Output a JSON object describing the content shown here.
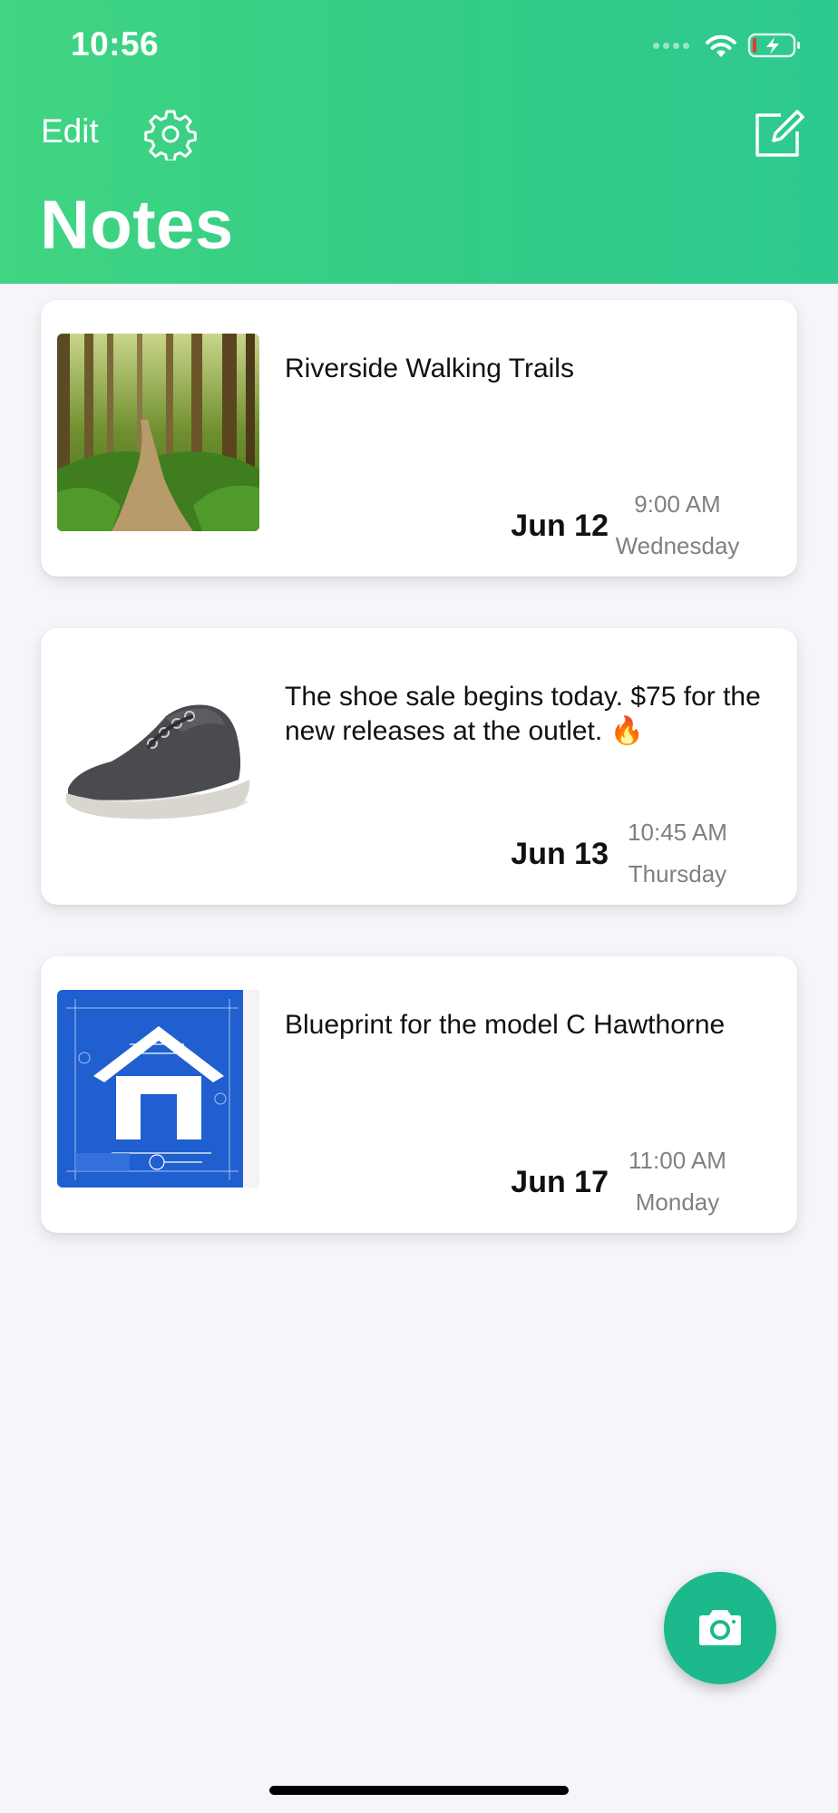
{
  "status_bar": {
    "time": "10:56"
  },
  "header": {
    "edit_label": "Edit",
    "title": "Notes"
  },
  "notes": [
    {
      "title": "Riverside Walking Trails",
      "date": "Jun 12",
      "time": "9:00 AM",
      "day": "Wednesday",
      "thumbnail": "forest-path-photo"
    },
    {
      "title": "The shoe sale begins today. $75 for the new releases at the outlet. 🔥",
      "date": "Jun 13",
      "time": "10:45 AM",
      "day": "Thursday",
      "thumbnail": "sneaker-photo"
    },
    {
      "title": "Blueprint for the model C Hawthorne",
      "date": "Jun 17",
      "time": "11:00 AM",
      "day": "Monday",
      "thumbnail": "house-blueprint-image"
    }
  ],
  "icons": {
    "settings": "gear-icon",
    "compose": "compose-icon",
    "camera": "camera-icon",
    "wifi": "wifi-icon",
    "battery": "battery-charging-icon"
  },
  "colors": {
    "header_gradient_start": "#40d582",
    "header_gradient_end": "#2ec98f",
    "fab": "#1bb98b",
    "background": "#f5f5fa"
  }
}
